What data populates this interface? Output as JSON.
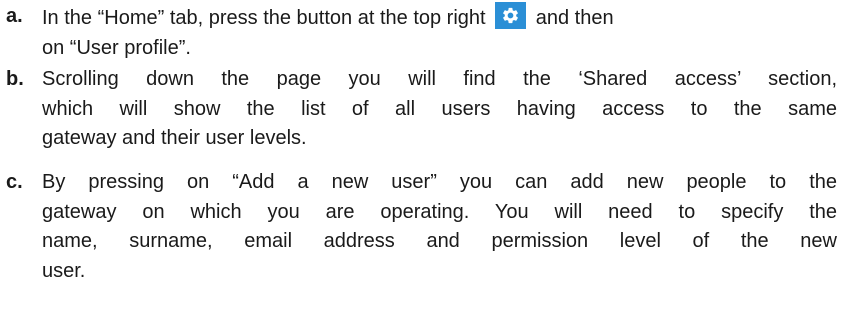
{
  "steps": [
    {
      "letter": "a.",
      "lines": [
        "In the “Home” tab,  press the button at the top right",
        "and then",
        "on “User profile”."
      ]
    },
    {
      "letter": "b.",
      "lines": [
        "Scrolling down the page you will find the ‘Shared access’ section,",
        "which will show the list of all users having access to the same",
        "gateway and their user levels."
      ]
    },
    {
      "letter": "c.",
      "lines": [
        "By pressing on “Add a new user” you can add new people to the",
        "gateway on which you are operating. You will need to specify the",
        "name, surname, email address and permission level of the new",
        "user."
      ]
    }
  ],
  "icons": {
    "settings": "gear-icon",
    "settings_bg": "#2b8fd6"
  }
}
